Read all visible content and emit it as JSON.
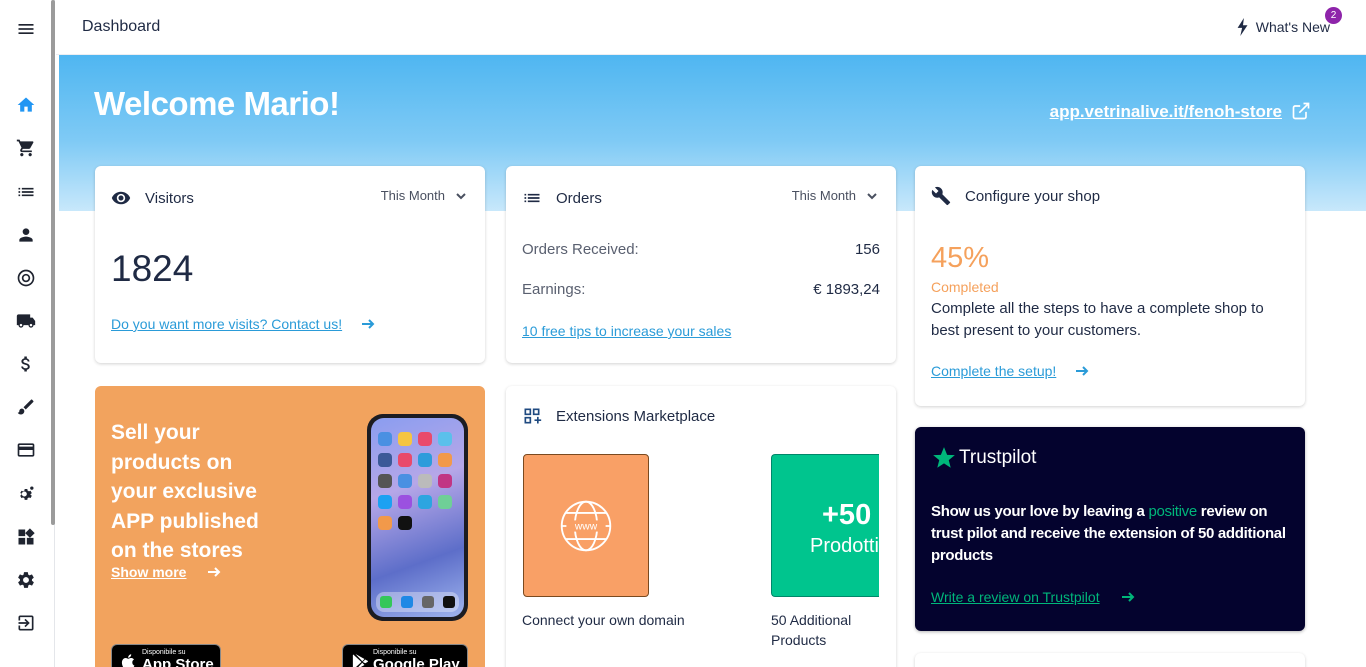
{
  "header": {
    "title": "Dashboard",
    "whats_new": "What's New",
    "whats_new_count": "2"
  },
  "hero": {
    "welcome": "Welcome Mario!",
    "store_url": "app.vetrinalive.it/fenoh-store"
  },
  "sidebar": {
    "items": [
      "menu-icon",
      "home-icon",
      "cart-icon",
      "list-icon",
      "person-icon",
      "target-icon",
      "truck-icon",
      "dollar-icon",
      "brush-icon",
      "credit-card-icon",
      "settings-gear-icon",
      "widgets-icon",
      "settings-icon",
      "logout-icon"
    ]
  },
  "visitors": {
    "title": "Visitors",
    "period": "This Month",
    "count": "1824",
    "link": "Do you want more visits? Contact us!"
  },
  "orders": {
    "title": "Orders",
    "period": "This Month",
    "received_label": "Orders Received:",
    "received_value": "156",
    "earnings_label": "Earnings:",
    "earnings_value": "€ 1893,24",
    "link": "10 free tips to increase your sales"
  },
  "configure": {
    "title": "Configure your shop",
    "percent": "45%",
    "progress": 45,
    "status": "Completed",
    "description": "Complete all the steps to have a complete shop to best present to your customers.",
    "link": "Complete the setup!"
  },
  "promo": {
    "text": "Sell your products on your exclusive APP published on the stores",
    "link": "Show more",
    "appstore_small": "Disponibile su",
    "appstore_big": "App Store",
    "googleplay_small": "Disponibile su",
    "googleplay_big": "Google Play"
  },
  "extensions": {
    "title": "Extensions Marketplace",
    "tiles": [
      {
        "caption": "Connect your own domain",
        "badge": "www",
        "color": "#f9a066"
      },
      {
        "caption": "50 Additional Products",
        "badge_top": "+50",
        "badge_bottom": "Prodotti",
        "color": "#00c58e"
      }
    ]
  },
  "trustpilot": {
    "brand": "Trustpilot",
    "text_1": "Show us your love by leaving a",
    "text_highlight": "positive",
    "text_2": "review on trust pilot and receive the extension of",
    "text_bold": "50 additional products",
    "link": "Write a review on Trustpilot"
  },
  "colors": {
    "accent": "#2196f3",
    "link": "#2a9bd8",
    "orange": "#f5a15c",
    "trust_green": "#00b67a",
    "trust_bg": "#04032e"
  }
}
